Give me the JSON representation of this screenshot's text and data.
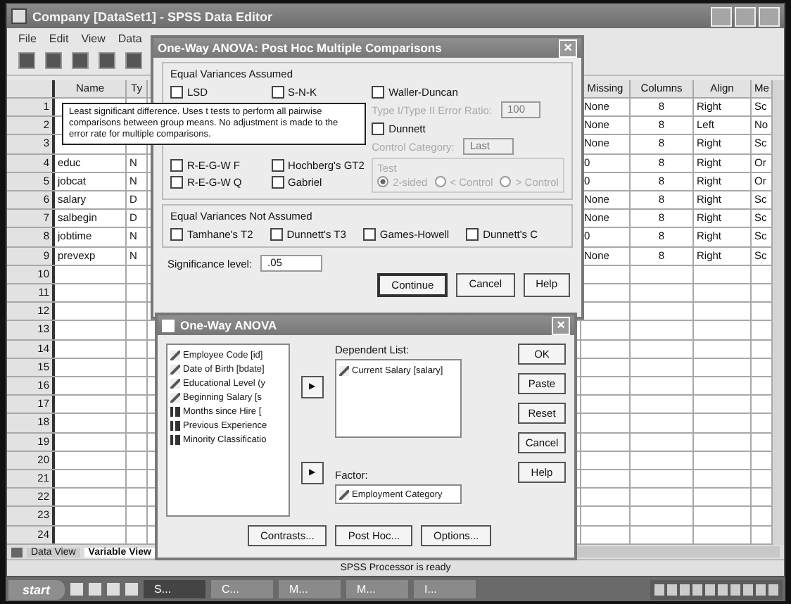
{
  "window": {
    "title": "Company [DataSet1] - SPSS Data Editor"
  },
  "menu": [
    "File",
    "Edit",
    "View",
    "Data"
  ],
  "grid": {
    "columns_left": [
      "Name",
      "Ty"
    ],
    "columns_right": [
      "Missing",
      "Columns",
      "Align",
      "Me"
    ],
    "rows": [
      {
        "number": "1",
        "missing": "None",
        "columns": "8",
        "align": "Right",
        "measure": "Sc"
      },
      {
        "number": "2",
        "missing": "None",
        "columns": "8",
        "align": "Left",
        "measure": "No"
      },
      {
        "number": "3",
        "missing": "None",
        "columns": "8",
        "align": "Right",
        "measure": "Sc"
      },
      {
        "number": "4",
        "name": "educ",
        "type": "N",
        "missing": "0",
        "columns": "8",
        "align": "Right",
        "measure": "Or"
      },
      {
        "number": "5",
        "name": "jobcat",
        "type": "N",
        "missing": "0",
        "columns": "8",
        "align": "Right",
        "measure": "Or"
      },
      {
        "number": "6",
        "name": "salary",
        "type": "D",
        "missing": "None",
        "columns": "8",
        "align": "Right",
        "measure": "Sc"
      },
      {
        "number": "7",
        "name": "salbegin",
        "type": "D",
        "missing": "None",
        "columns": "8",
        "align": "Right",
        "measure": "Sc"
      },
      {
        "number": "8",
        "name": "jobtime",
        "type": "N",
        "missing": "0",
        "columns": "8",
        "align": "Right",
        "measure": "Sc"
      },
      {
        "number": "9",
        "name": "prevexp",
        "type": "N",
        "missing": "None",
        "columns": "8",
        "align": "Right",
        "measure": "Sc"
      },
      {
        "number": "10"
      },
      {
        "number": "11"
      },
      {
        "number": "12"
      },
      {
        "number": "13"
      },
      {
        "number": "14"
      },
      {
        "number": "15"
      },
      {
        "number": "16"
      },
      {
        "number": "17"
      },
      {
        "number": "18"
      },
      {
        "number": "19"
      },
      {
        "number": "20"
      },
      {
        "number": "21"
      },
      {
        "number": "22"
      },
      {
        "number": "23"
      },
      {
        "number": "24"
      }
    ]
  },
  "sheet_tabs": [
    {
      "label": "Data View",
      "selected": false
    },
    {
      "label": "Variable View",
      "selected": true
    }
  ],
  "status_bar": "SPSS Processor is ready",
  "tooltip": "Least significant difference. Uses t tests to perform all pairwise comparisons between group means. No adjustment is made to the error rate for multiple comparisons.",
  "post_hoc": {
    "title": "One-Way ANOVA: Post Hoc Multiple Comparisons",
    "close": "×",
    "assumed_label": "Equal Variances Assumed",
    "col_a_top": [
      {
        "label": "LSD",
        "checked": false
      }
    ],
    "col_a_bottom": [
      {
        "label": "R-E-G-W F",
        "checked": false
      },
      {
        "label": "R-E-G-W Q",
        "checked": false
      }
    ],
    "col_b_top": [
      {
        "label": "S-N-K",
        "checked": false
      }
    ],
    "col_b_bottom": [
      {
        "label": "Hochberg's GT2",
        "checked": false
      },
      {
        "label": "Gabriel",
        "checked": false
      }
    ],
    "waller": {
      "label": "Waller-Duncan",
      "checked": false
    },
    "ratio": {
      "label": "Type I/Type II Error Ratio:",
      "value": "100"
    },
    "dunnett": {
      "label": "Dunnett",
      "checked": false
    },
    "control": {
      "label": "Control Category:",
      "value": "Last"
    },
    "test": {
      "label": "Test",
      "options": [
        {
          "label": "2-sided",
          "selected": true
        },
        {
          "label": "< Control",
          "selected": false
        },
        {
          "label": "> Control",
          "selected": false
        }
      ]
    },
    "not_assumed_label": "Equal Variances Not Assumed",
    "not_assumed": [
      {
        "label": "Tamhane's T2",
        "checked": false
      },
      {
        "label": "Dunnett's T3",
        "checked": false
      },
      {
        "label": "Games-Howell",
        "checked": false
      },
      {
        "label": "Dunnett's C",
        "checked": false
      }
    ],
    "significance": {
      "label": "Significance level:",
      "value": ".05"
    },
    "buttons": [
      "Continue",
      "Cancel",
      "Help"
    ]
  },
  "anova": {
    "title": "One-Way ANOVA",
    "close": "×",
    "move_buttons": [
      "▶",
      "▶"
    ],
    "variables": [
      {
        "label": "Employee Code [id]",
        "kind": "scale"
      },
      {
        "label": "Date of Birth [bdate]",
        "kind": "scale"
      },
      {
        "label": "Educational Level (y",
        "kind": "scale"
      },
      {
        "label": "Beginning Salary [s",
        "kind": "scale"
      },
      {
        "label": "Months since Hire [",
        "kind": "nominal"
      },
      {
        "label": "Previous Experience",
        "kind": "nominal"
      },
      {
        "label": "Minority Classificatio",
        "kind": "nominal"
      }
    ],
    "dependent_label": "Dependent List:",
    "dependent": [
      {
        "label": "Current Salary [salary]",
        "kind": "scale"
      }
    ],
    "factor_label": "Factor:",
    "factor": {
      "label": "Employment Category",
      "kind": "scale"
    },
    "side_buttons": [
      "OK",
      "Paste",
      "Reset",
      "Cancel",
      "Help"
    ],
    "bottom_buttons": [
      "Contrasts...",
      "Post Hoc...",
      "Options..."
    ]
  },
  "taskbar": {
    "start": "start",
    "tasks": [
      "S...",
      "C...",
      "M...",
      "M...",
      "I..."
    ]
  }
}
